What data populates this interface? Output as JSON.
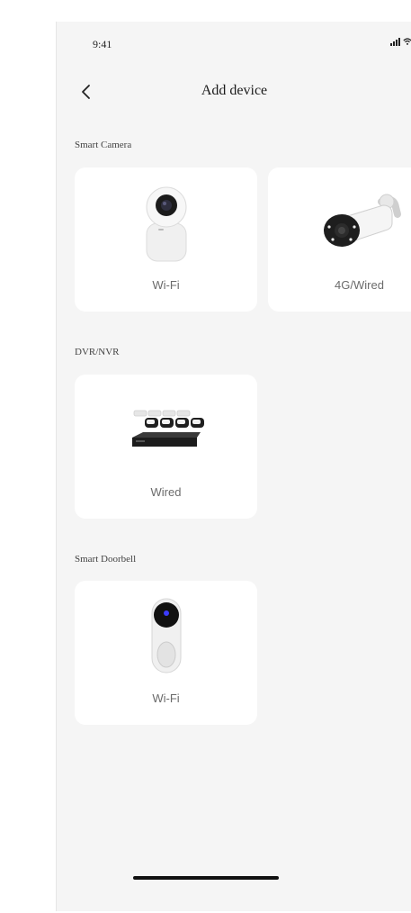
{
  "status_bar": {
    "time": "9:41"
  },
  "header": {
    "title": "Add device",
    "back_icon": "chevron-left-icon"
  },
  "sections": [
    {
      "title": "Smart Camera",
      "cards": [
        {
          "label": "Wi-Fi",
          "icon": "indoor-camera-icon"
        },
        {
          "label": "4G/Wired",
          "icon": "bullet-camera-icon"
        }
      ]
    },
    {
      "title": "DVR/NVR",
      "cards": [
        {
          "label": "Wired",
          "icon": "nvr-kit-icon"
        }
      ]
    },
    {
      "title": "Smart Doorbell",
      "cards": [
        {
          "label": "Wi-Fi",
          "icon": "doorbell-icon"
        }
      ]
    }
  ]
}
